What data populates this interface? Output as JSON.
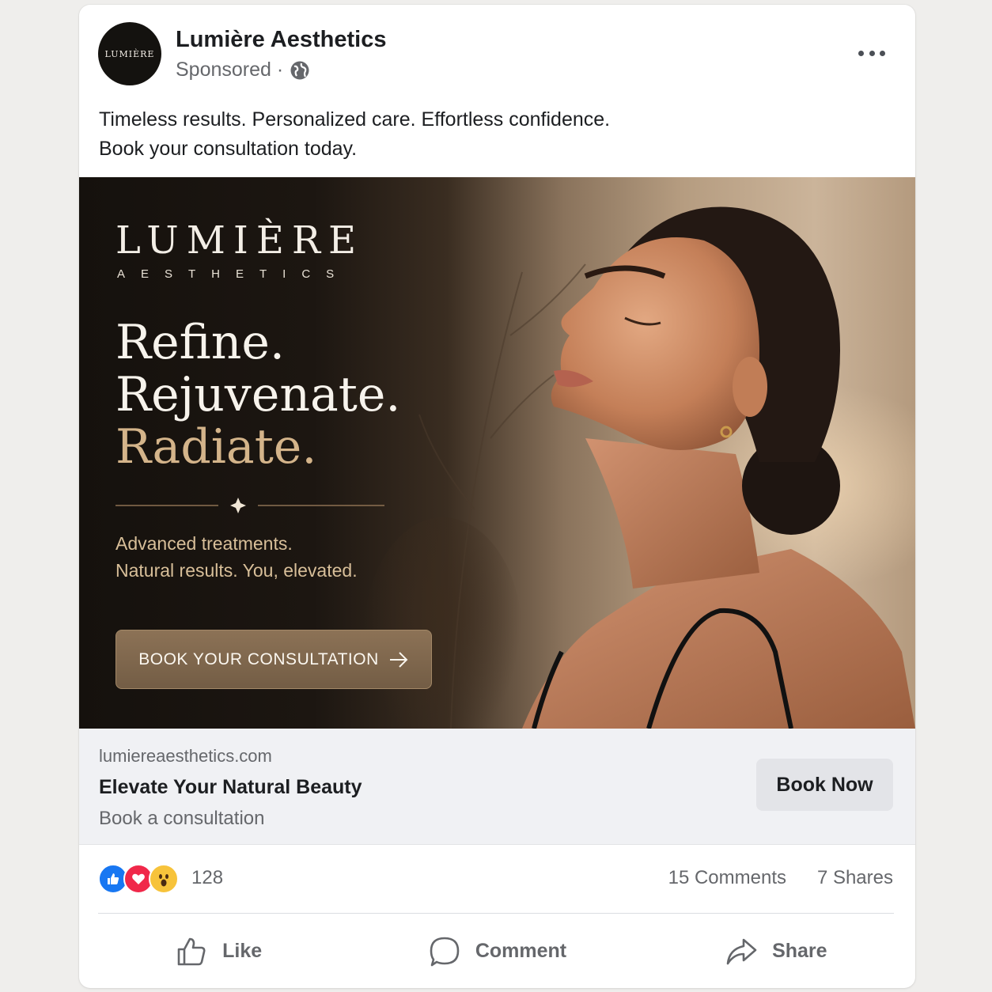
{
  "post": {
    "page_name": "Lumière Aesthetics",
    "avatar_text": "LUMIÈRE",
    "sponsored": "Sponsored ·",
    "caption_line1": "Timeless results. Personalized care. Effortless confidence.",
    "caption_line2": "Book your consultation today."
  },
  "ad": {
    "brand": "LUMIÈRE",
    "brand_sub": "AESTHETICS",
    "headline_1": "Refine.",
    "headline_2": "Rejuvenate.",
    "headline_3": "Radiate.",
    "tagline_1": "Advanced treatments.",
    "tagline_2": "Natural results. You, elevated.",
    "cta": "BOOK YOUR CONSULTATION",
    "accent_color": "#d4b48a"
  },
  "link": {
    "domain": "lumiereaesthetics.com",
    "title": "Elevate Your Natural Beauty",
    "description": "Book a consultation",
    "button": "Book Now"
  },
  "engagement": {
    "reaction_count": "128",
    "comments": "15 Comments",
    "shares": "7 Shares",
    "reaction_icons": [
      "like-icon",
      "love-icon",
      "wow-icon"
    ]
  },
  "actions": {
    "like": "Like",
    "comment": "Comment",
    "share": "Share"
  }
}
